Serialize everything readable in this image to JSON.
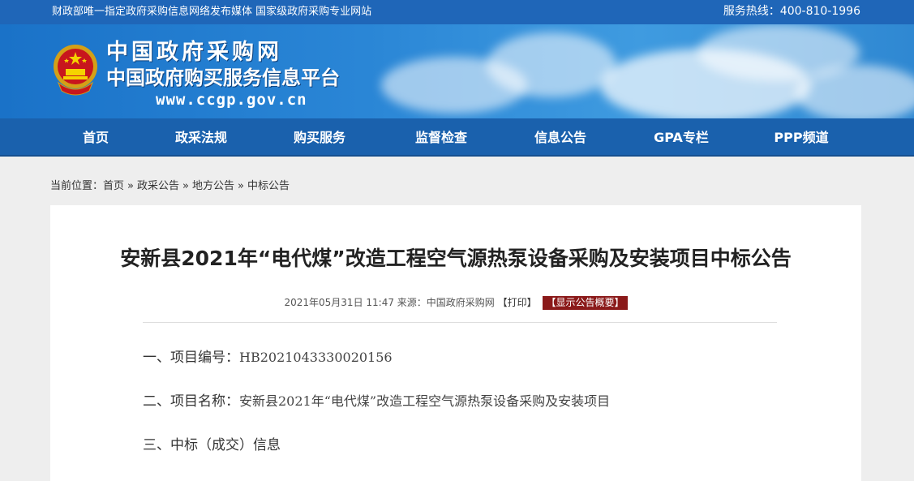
{
  "topbar": {
    "slogan": "财政部唯一指定政府采购信息网络发布媒体 国家级政府采购专业网站",
    "hotline": "服务热线：400-810-1996"
  },
  "banner": {
    "site_name": "中国政府采购网",
    "platform_name": "中国政府购买服务信息平台",
    "url": "www.ccgp.gov.cn",
    "colors": {
      "primary": "#1a61ad",
      "accent_red": "#8b1a1a"
    }
  },
  "nav": {
    "items": [
      "首页",
      "政采法规",
      "购买服务",
      "监督检查",
      "信息公告",
      "GPA专栏",
      "PPP频道"
    ]
  },
  "breadcrumb": {
    "prefix": "当前位置：",
    "items": [
      "首页",
      "政采公告",
      "地方公告",
      "中标公告"
    ],
    "separator": "»"
  },
  "article": {
    "title": "安新县2021年“电代煤”改造工程空气源热泵设备采购及安装项目中标公告",
    "meta": {
      "datetime": "2021年05月31日 11:47",
      "source": "来源：中国政府采购网",
      "print_label": "【打印】",
      "summary_label": "【显示公告概要】"
    },
    "sections": [
      {
        "label": "一、项目编号：",
        "value": "HB2021043330020156"
      },
      {
        "label": "二、项目名称：",
        "value": "安新县2021年“电代煤”改造工程空气源热泵设备采购及安装项目"
      },
      {
        "label": "三、中标（成交）信息",
        "value": ""
      }
    ]
  }
}
